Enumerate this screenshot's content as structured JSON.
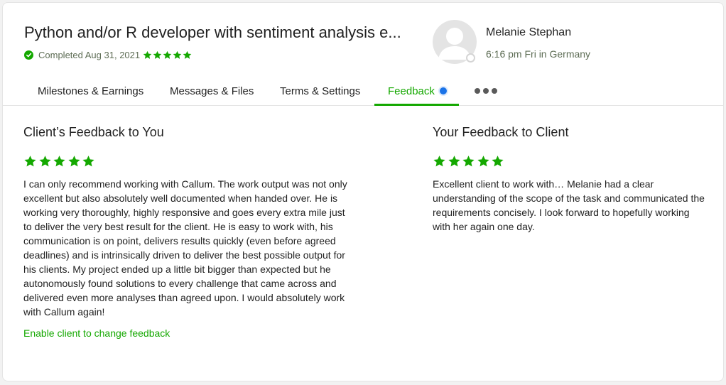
{
  "contract": {
    "title": "Python and/or R developer with sentiment analysis e...",
    "status": "Completed Aug 31, 2021",
    "rating_stars": 5
  },
  "client": {
    "name": "Melanie Stephan",
    "local_time": "6:16 pm Fri in Germany"
  },
  "tabs": [
    {
      "label": "Milestones & Earnings"
    },
    {
      "label": "Messages & Files"
    },
    {
      "label": "Terms & Settings"
    },
    {
      "label": "Feedback",
      "active": true
    }
  ],
  "client_feedback": {
    "heading": "Client’s Feedback to You",
    "stars": 5,
    "text": "I can only recommend working with Callum. The work output was not only excellent but also absolutely well documented when handed over. He is working very thoroughly, highly responsive and goes every extra mile just to deliver the very best result for the client. He is easy to work with, his communication is on point, delivers results quickly (even before agreed deadlines) and is intrinsically driven to deliver the best possible output for his clients. My project ended up a little bit bigger than expected but he autonomously found solutions to every challenge that came across and delivered even more analyses than agreed upon. I would absolutely work with Callum again!",
    "enable_link": "Enable client to change feedback"
  },
  "your_feedback": {
    "heading": "Your Feedback to Client",
    "stars": 5,
    "text": "Excellent client to work with… Melanie had a clear understanding of the scope of the task and communicated the requirements concisely. I look forward to hopefully working with her again one day."
  },
  "colors": {
    "accent": "#14a800",
    "notification_dot": "#1a73e8"
  }
}
